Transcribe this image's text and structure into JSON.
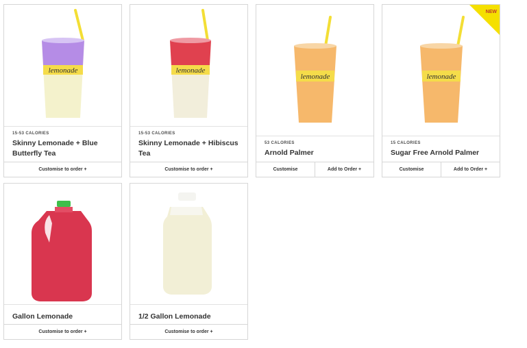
{
  "products": [
    {
      "calories": "15-53 CALORIES",
      "name": "Skinny Lemonade + Blue Butterfly Tea",
      "action": "Customise to order +",
      "top_color": "#b58ce6",
      "cup_label": "lemonade"
    },
    {
      "calories": "15-53 CALORIES",
      "name": "Skinny Lemonade + Hibiscus Tea",
      "action": "Customise to order +",
      "top_color": "#e0414f",
      "cup_label": "lemonade"
    },
    {
      "calories": "53 CALORIES",
      "name": "Arnold Palmer",
      "action_left": "Customise",
      "action_right": "Add to Order +",
      "top_color": "#f6b86b",
      "cup_label": "lemonade"
    },
    {
      "calories": "15 CALORIES",
      "name": "Sugar Free Arnold Palmer",
      "action_left": "Customise",
      "action_right": "Add to Order +",
      "top_color": "#f6b86b",
      "cup_label": "lemonade",
      "badge": "NEW"
    },
    {
      "name": "Gallon Lemonade",
      "action": "Customise to order +"
    },
    {
      "name": "1/2 Gallon Lemonade",
      "action": "Customise to order +"
    }
  ],
  "colors": {
    "straw": "#f3de35",
    "cup_yellow": "#f5dc4a",
    "pink": "#d9364f",
    "milky": "#f2efd6"
  }
}
